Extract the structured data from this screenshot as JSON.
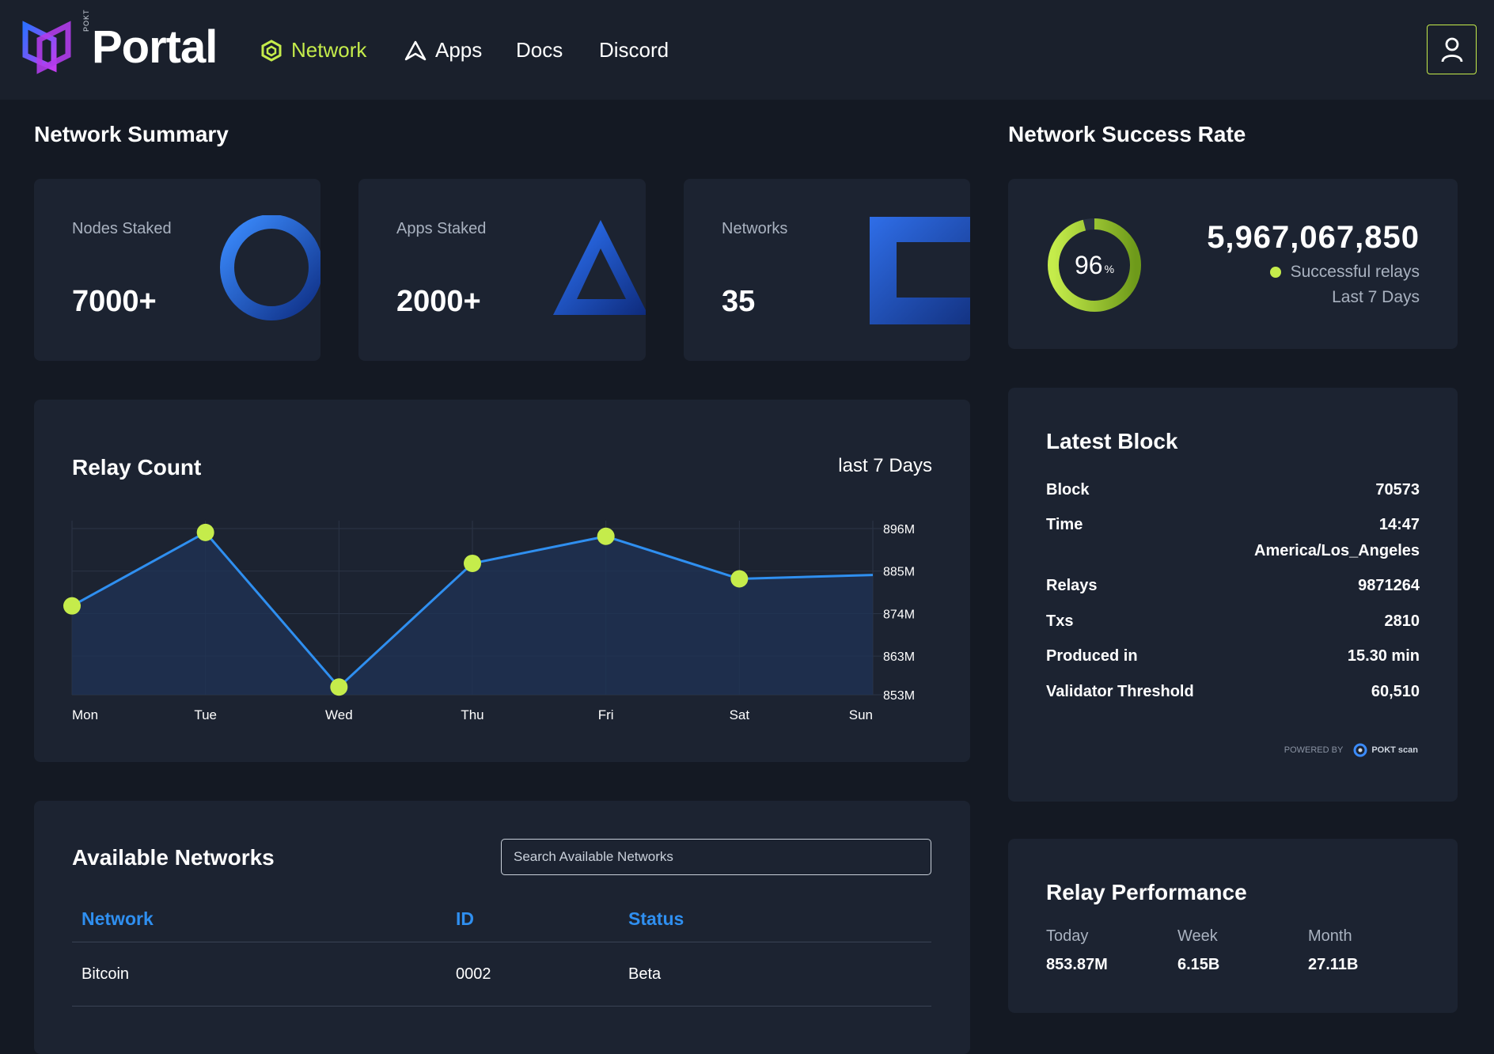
{
  "header": {
    "brand_small": "POKT",
    "brand": "Portal",
    "nav": [
      {
        "label": "Network",
        "active": true
      },
      {
        "label": "Apps",
        "active": false
      },
      {
        "label": "Docs",
        "active": false
      },
      {
        "label": "Discord",
        "active": false
      }
    ],
    "user_icon": "user-icon"
  },
  "summary": {
    "title": "Network Summary",
    "cards": [
      {
        "label": "Nodes Staked",
        "value": "7000+",
        "icon": "ring-shape"
      },
      {
        "label": "Apps Staked",
        "value": "2000+",
        "icon": "triangle-shape"
      },
      {
        "label": "Networks",
        "value": "35",
        "icon": "square-shape"
      }
    ]
  },
  "success": {
    "title": "Network Success Rate",
    "percent": 96,
    "percent_value": "96",
    "percent_unit": "%",
    "total": "5,967,067,850",
    "caption": "Successful relays",
    "period": "Last 7 Days",
    "accent": "#c5ec4b"
  },
  "relay_count": {
    "title": "Relay Count",
    "period": "last 7 Days"
  },
  "chart_data": {
    "type": "line",
    "categories": [
      "Mon",
      "Tue",
      "Wed",
      "Thu",
      "Fri",
      "Sat",
      "Sun"
    ],
    "values": [
      876,
      895,
      855,
      887,
      894,
      883,
      884
    ],
    "yticks": [
      896,
      885,
      874,
      863,
      853
    ],
    "ytick_labels": [
      "896M",
      "885M",
      "874M",
      "863M",
      "853M"
    ],
    "ylim": [
      853,
      896
    ],
    "grid": true,
    "line_color": "#2f8ff0",
    "point_color": "#c5ec4b"
  },
  "latest_block": {
    "title": "Latest Block",
    "rows": [
      {
        "key": "Block",
        "value": "70573"
      },
      {
        "key": "Time",
        "value": "14:47",
        "value2": "America/Los_Angeles"
      },
      {
        "key": "Relays",
        "value": "9871264"
      },
      {
        "key": "Txs",
        "value": "2810"
      },
      {
        "key": "Produced in",
        "value": "15.30 min"
      },
      {
        "key": "Validator Threshold",
        "value": "60,510"
      }
    ],
    "powered_by": "POWERED BY",
    "powered_brand": "POKT scan"
  },
  "networks": {
    "title": "Available Networks",
    "search_placeholder": "Search Available Networks",
    "columns": [
      "Network",
      "ID",
      "Status"
    ],
    "rows": [
      {
        "network": "Bitcoin",
        "id": "0002",
        "status": "Beta"
      }
    ]
  },
  "performance": {
    "title": "Relay Performance",
    "items": [
      {
        "label": "Today",
        "value": "853.87M"
      },
      {
        "label": "Week",
        "value": "6.15B"
      },
      {
        "label": "Month",
        "value": "27.11B"
      }
    ]
  }
}
